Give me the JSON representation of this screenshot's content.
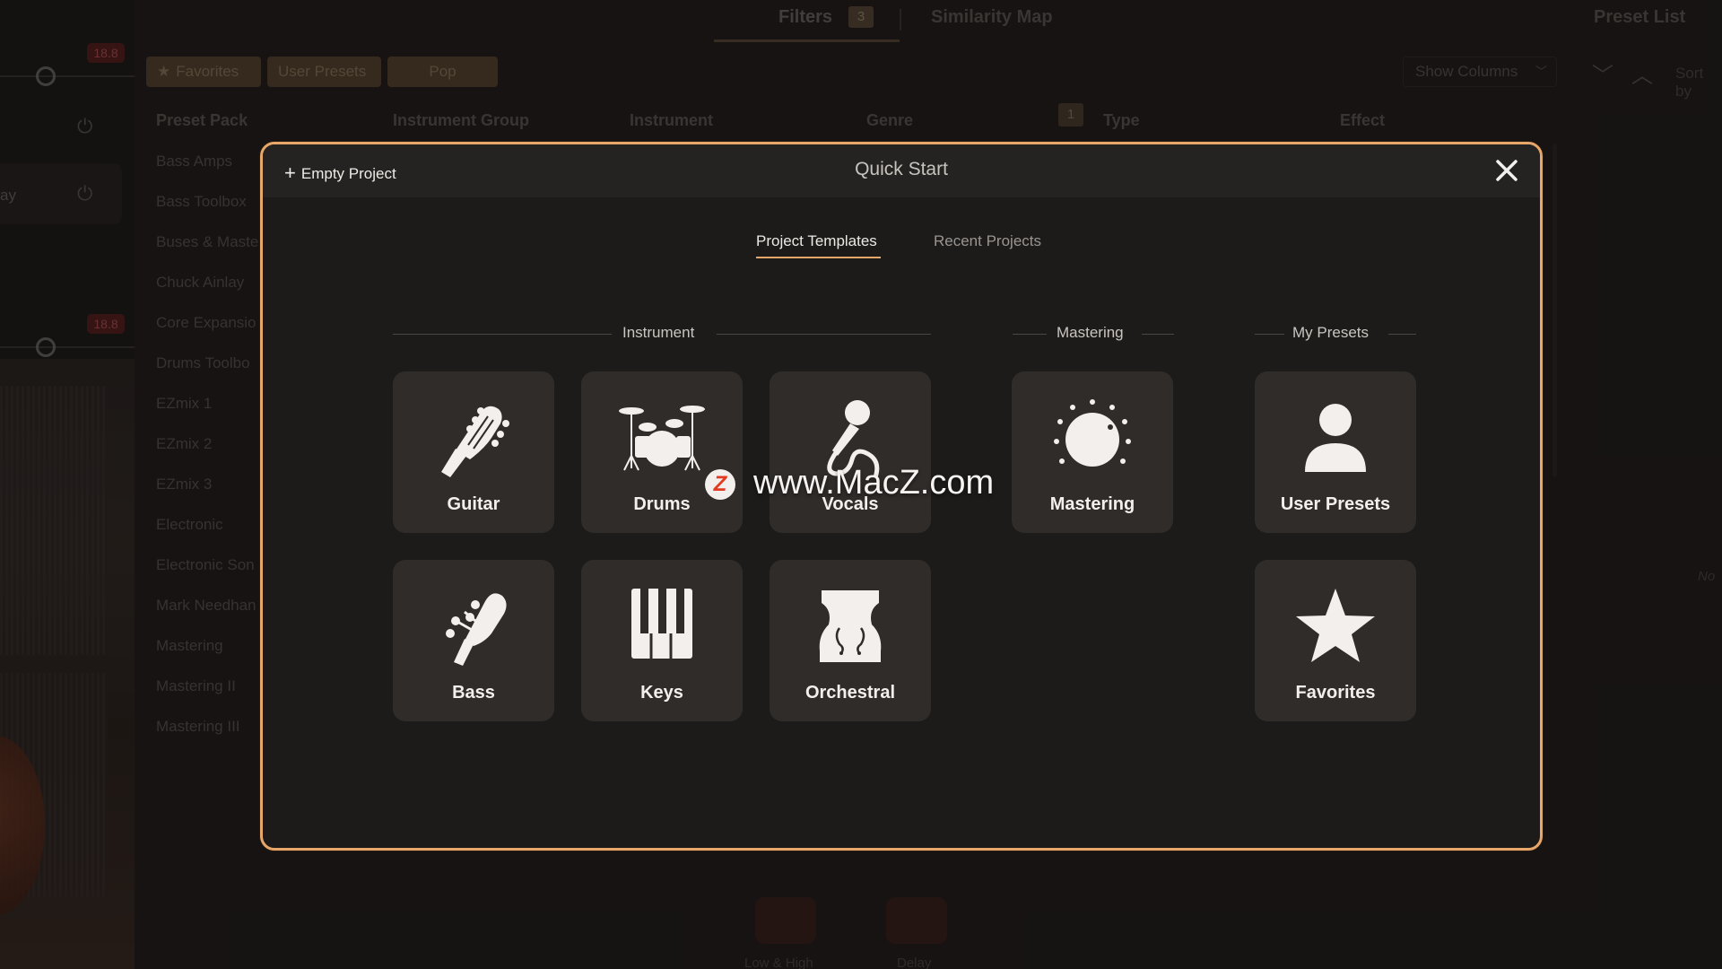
{
  "background": {
    "top_tabs": {
      "filters": "Filters",
      "filters_count": "3",
      "similarity_map": "Similarity Map",
      "preset_list": "Preset List"
    },
    "filter_chips": {
      "favorites": "Favorites",
      "user_presets": "User Presets",
      "pop": "Pop"
    },
    "show_columns": "Show Columns",
    "sort_by": "Sort by",
    "columns": [
      "Preset Pack",
      "Instrument Group",
      "Instrument",
      "Genre",
      "Type",
      "Effect"
    ],
    "type_badge": "1",
    "preset_packs": [
      "Bass Amps",
      "Bass Toolbox",
      "Buses & Maste",
      "Chuck Ainlay",
      "Core Expansio",
      "Drums Toolbo",
      "EZmix 1",
      "EZmix 2",
      "EZmix 3",
      "Electronic",
      "Electronic Son",
      "Mark Needhan",
      "Mastering",
      "Mastering II",
      "Mastering III"
    ],
    "rail_badges": [
      "18.8",
      "18.8"
    ],
    "rail_label": "ay",
    "right_hint": "No",
    "bottom_labels": [
      "Low & High",
      "Delay"
    ]
  },
  "modal": {
    "empty_project": "Empty Project",
    "title": "Quick Start",
    "tabs": {
      "active": "Project Templates",
      "inactive": "Recent Projects"
    },
    "sections": {
      "instrument": "Instrument",
      "mastering": "Mastering",
      "my_presets": "My Presets"
    },
    "tiles": {
      "guitar": "Guitar",
      "drums": "Drums",
      "vocals": "Vocals",
      "mastering": "Mastering",
      "user_presets": "User Presets",
      "bass": "Bass",
      "keys": "Keys",
      "orchestral": "Orchestral",
      "favorites": "Favorites"
    }
  },
  "watermark": {
    "logo": "Z",
    "text": "www.MacZ.com"
  },
  "colors": {
    "accent": "#e8a76a",
    "tile": "#2f2c2a",
    "modal_bg": "#1d1b1a"
  }
}
